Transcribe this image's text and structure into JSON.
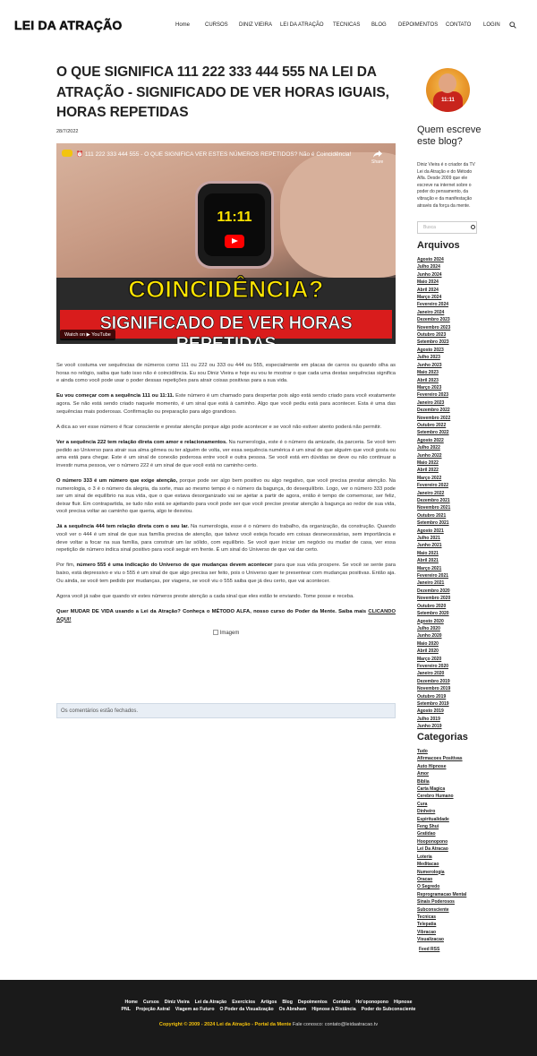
{
  "header": {
    "logo": "LEI DA ATRAÇÃO",
    "nav": [
      "Home",
      "CURSOS",
      "DINIZ VIEIRA",
      "LEI DA ATRAÇÃO",
      "TECNICAS",
      "BLOG",
      "DEPOIMENTOS",
      "CONTATO",
      "LOGIN"
    ]
  },
  "post": {
    "title": "O QUE SIGNIFICA 111 222 333 444 555 NA LEI DA ATRAÇÃO - SIGNIFICADO DE VER HORAS IGUAIS, HORAS REPETIDAS",
    "date": "28/7/2022",
    "video": {
      "title": "⏰ 111 222 333 444 555 - O QUE SIGNIFICA VER ESTES NÚMEROS REPETIDOS? Não é Coincidência!",
      "share": "Share",
      "watch_time": "11:11",
      "headline1": "COINCIDÊNCIA?",
      "headline2": "SIGNIFICADO DE VER HORAS REPETIDAS",
      "watch_on": "Watch on  ▶ YouTube"
    },
    "paragraphs": [
      {
        "lead": "",
        "text": "Se você costuma ver sequências de números como 111 ou 222 ou 333 ou 444 ou 555, especialmente em placas de carros ou quando olha as horas no relógio, saiba que tudo isso não é coincidência. Eu sou Diniz Vieira e hoje eu vou te mostrar o que cada uma destas sequências significa e ainda como você pode usar o poder dessas repetições para atrair coisas positivas para a sua vida."
      },
      {
        "lead": "Eu vou começar com a sequência 111 ou 11:11.",
        "text": " Este número é um chamado para despertar pois algo está sendo criado para você exatamente agora. Se não está sendo criado naquele momento, é um sinal que está à caminho. Algo que você pediu está para acontecer. Esta é uma das sequências mais poderosas. Confirmação ou preparação para algo grandioso."
      },
      {
        "lead": "",
        "text": "A dica ao ver esse número é ficar consciente e prestar atenção porque algo pode acontecer e se você não estiver atento poderá não permitir."
      },
      {
        "lead": "Ver a sequência 222 tem relação direta com amor e relacionamentos.",
        "text": " Na numerologia, este é o número da amizade, da parceria. Se você tem pedido ao Universo para atrair sua alma gêmea ou ter alguém de volta, ver essa sequência numérica é um sinal de que alguém que você gosta ou ama está para chegar. Este é um sinal de conexão poderosa entre você e outra pessoa. Se você está em dúvidas se deve ou não continuar a investir numa pessoa, ver o número 222 é um sinal de que você está no caminho certo."
      },
      {
        "lead": "O número 333 é um número que exige atenção,",
        "text": " porque pode ser algo bem positivo ou algo negativo, que você precisa prestar atenção. Na numerologia, o 3 é o número da alegria, da sorte, mas ao mesmo tempo é o número da bagunça, do desequilíbrio. Logo, ver o número 333 pode ser um sinal de equilíbrio na sua vida, que o que estava desorganizado vai se ajeitar a partir de agora, então é tempo de comemorar, ser feliz, deixar fluir. Em contrapartida, se tudo não está se ajeitando para você pode ser que você precise prestar atenção à bagunça ao redor de sua vida, você precisa voltar ao caminho que queria, algo te desviou."
      },
      {
        "lead": "Já a sequência 444 tem relação direta com o seu lar.",
        "text": " Na numerologia, esse é o número do trabalho, da organização, da construção. Quando você ver o 444 é um sinal de que sua família precisa de atenção, que talvez você esteja focado em coisas desnecessárias, sem importância e deve voltar a focar na sua família, para construir um lar sólido, com equilíbrio. Se você quer iniciar um negócio ou mudar de casa, ver essa repetição de número indica sinal positivo para você seguir em frente. É um sinal do Universo de que vai dar certo."
      },
      {
        "lead": "",
        "text": "Por fim, número 555 é uma indicação do Universo de que mudanças devem acontecer para que sua vida prospere. Se você se sente para baixo, está depressivo e viu o 555 é um sinal de que algo precisa ser feito, pois o Universo quer te presentear com mudanças positivas. Então aja. Ou ainda, se você tem pedido por mudanças, por viagens, se você viu o 555 saiba que já deu certo, que vai acontecer."
      },
      {
        "lead": "",
        "text": "Agora você já sabe que quando vir estes números preste atenção a cada sinal que eles estão te enviando. Tome posse e receba."
      }
    ],
    "p7_bold": "número 555 é uma indicação do Universo de que mudanças devem acontecer",
    "cta_text": "Quer MUDAR DE VIDA usando a Lei da Atração? Conheça o MÉTODO ALFA, nosso curso do Poder da Mente. Saiba mais ",
    "cta_link": "CLICANDO AQUI!",
    "image_alt": "Imagem",
    "comments_closed": "Os comentários estão fechados."
  },
  "sidebar": {
    "avatar_text": "11:11",
    "who_title": "Quem escreve este blog?",
    "who_text": "Diniz Vieira é o criador da TV Lei da Atração e do Método Alfa. Desde 2009 que ele escreve na internet sobre o poder do pensamento, da vibração e da manifestação através da força da mente.",
    "search_placeholder": "Busca",
    "archives_title": "Arquivos",
    "archives": [
      "Agosto 2024",
      "Julho 2024",
      "Junho 2024",
      "Maio 2024",
      "Abril 2024",
      "Março 2024",
      "Fevereiro 2024",
      "Janeiro 2024",
      "Dezembro 2023",
      "Novembro 2023",
      "Outubro 2023",
      "Setembro 2023",
      "Agosto 2023",
      "Julho 2023",
      "Junho 2023",
      "Maio 2023",
      "Abril 2023",
      "Março 2023",
      "Fevereiro 2023",
      "Janeiro 2023",
      "Dezembro 2022",
      "Novembro 2022",
      "Outubro 2022",
      "Setembro 2022",
      "Agosto 2022",
      "Julho 2022",
      "Junho 2022",
      "Maio 2022",
      "Abril 2022",
      "Março 2022",
      "Fevereiro 2022",
      "Janeiro 2022",
      "Dezembro 2021",
      "Novembro 2021",
      "Outubro 2021",
      "Setembro 2021",
      "Agosto 2021",
      "Julho 2021",
      "Junho 2021",
      "Maio 2021",
      "Abril 2021",
      "Março 2021",
      "Fevereiro 2021",
      "Janeiro 2021",
      "Dezembro 2020",
      "Novembro 2020",
      "Outubro 2020",
      "Setembro 2020",
      "Agosto 2020",
      "Julho 2020",
      "Junho 2020",
      "Maio 2020",
      "Abril 2020",
      "Março 2020",
      "Fevereiro 2020",
      "Janeiro 2020",
      "Dezembro 2019",
      "Novembro 2019",
      "Outubro 2019",
      "Setembro 2019",
      "Agosto 2019",
      "Julho 2019",
      "Junho 2019"
    ],
    "categories_title": "Categorias",
    "categories": [
      "Tudo",
      "Afirmacoes Positivas",
      "Auto Hipnose",
      "Amor",
      "Bíblia",
      "Carta Magica",
      "Cerebro Humano",
      "Cura",
      "Dinheiro",
      "Espiritualidade",
      "Feng Shui",
      "Gratidao",
      "Hooponopono",
      "Lei Da Atracao",
      "Loteria",
      "Meditacao",
      "Numerologia",
      "Oracao",
      "O Segredo",
      "Reprogramacao Mental",
      "Sinais Poderosos",
      "Subconsciente",
      "Tecnicas",
      "Telepatia",
      "Vibracao",
      "Visualizacao"
    ],
    "feed": "Feed RSS"
  },
  "footer": {
    "row1": [
      "Home",
      "Cursos",
      "Diniz Vieira",
      "Lei da Atração",
      "Exercícios",
      "Artigos",
      "Blog",
      "Depoimentos",
      "Contato",
      "Ho'oponopono",
      "Hipnose"
    ],
    "row2": [
      "PNL",
      "Projeção Astral",
      "Viagem ao Futuro",
      "O Poder da Visualização",
      "Os Abraham",
      "Hipnose à Distância",
      "Poder do Subconsciente"
    ],
    "copyright": "Copyright © 2009 - 2024 Lei da Atração - Portal da Mente",
    "contact": " Fale conosco: contato@leidaatracao.tv"
  }
}
